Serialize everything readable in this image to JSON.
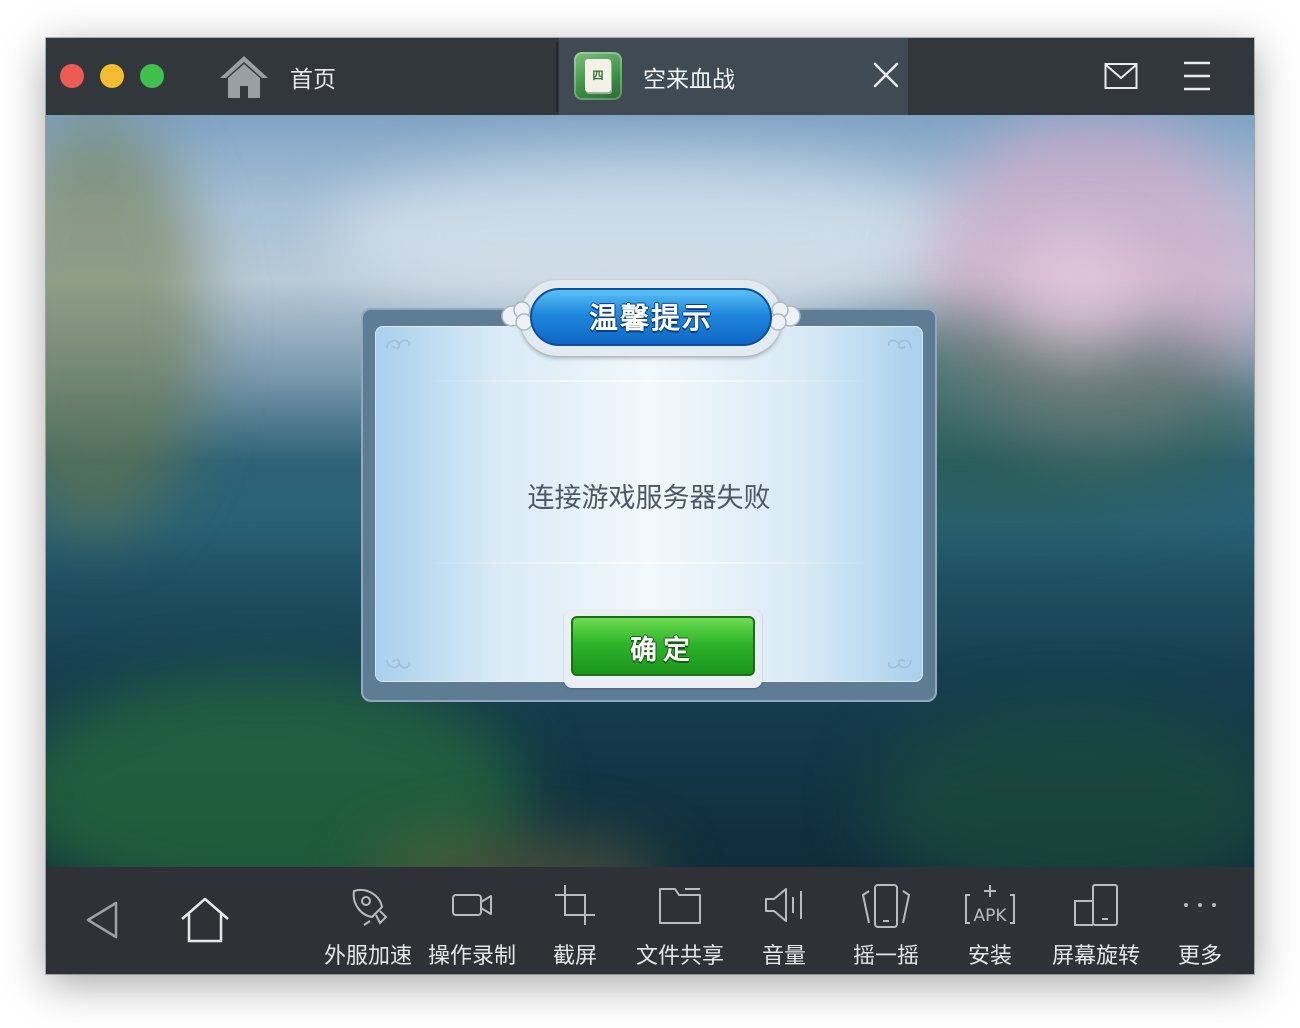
{
  "titlebar": {
    "home_tab_label": "首页",
    "game_tab_title": "空来血战",
    "game_tab_icon_glyph": "四",
    "icons": [
      "home-icon",
      "close-icon",
      "mail-icon",
      "menu-icon"
    ]
  },
  "dialog": {
    "title": "温馨提示",
    "message": "连接游戏服务器失败",
    "confirm_label": "确定"
  },
  "toolbar": {
    "nav": [
      "back-icon",
      "home-icon"
    ],
    "items": [
      {
        "label": "外服加速",
        "icon": "rocket-icon"
      },
      {
        "label": "操作录制",
        "icon": "video-camera-icon"
      },
      {
        "label": "截屏",
        "icon": "crop-icon"
      },
      {
        "label": "文件共享",
        "icon": "folder-icon"
      },
      {
        "label": "音量",
        "icon": "speaker-icon"
      },
      {
        "label": "摇一摇",
        "icon": "shake-phone-icon"
      },
      {
        "label": "安装",
        "icon": "apk-install-icon"
      },
      {
        "label": "屏幕旋转",
        "icon": "rotate-screen-icon"
      },
      {
        "label": "更多",
        "icon": "more-icon"
      }
    ],
    "apk_text": "APK"
  },
  "colors": {
    "titlebar_bg": "#32373c",
    "active_tab_bg": "#3f4a52",
    "toolbar_bg": "#2e3236",
    "dialog_title_blue": "#1e88dd",
    "confirm_green": "#2eb52a",
    "traffic_red": "#ee5b52",
    "traffic_yellow": "#f4bc2f",
    "traffic_green": "#3fc04a"
  }
}
